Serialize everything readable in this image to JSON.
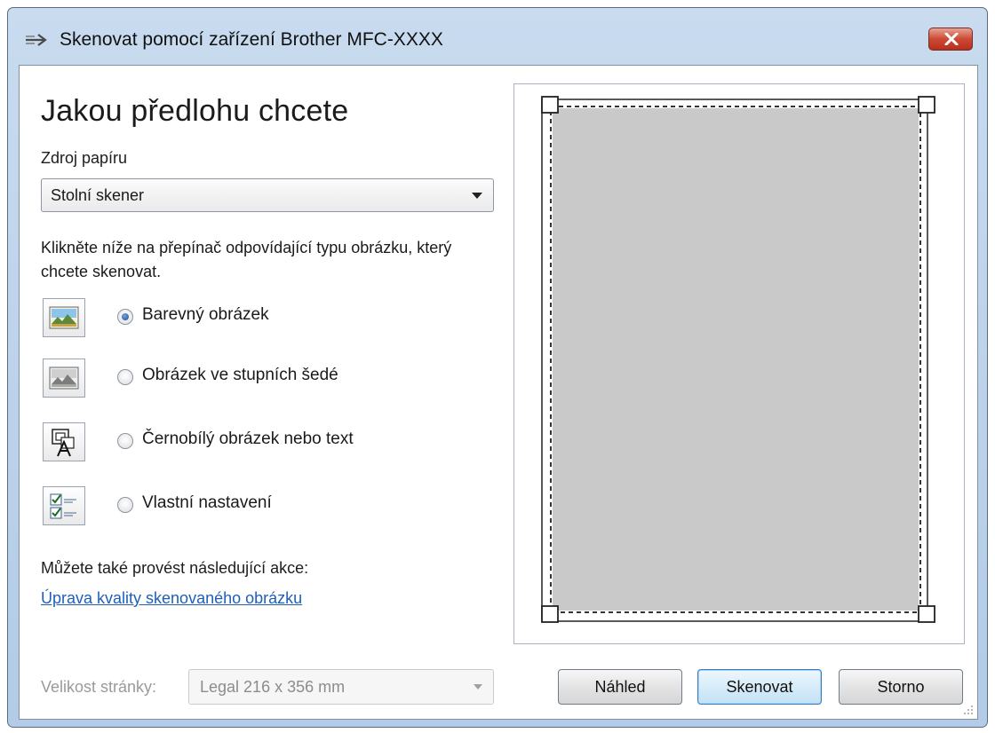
{
  "window": {
    "title": "Skenovat pomocí zařízení Brother MFC-XXXX"
  },
  "main": {
    "heading": "Jakou předlohu chcete",
    "paper_source_label": "Zdroj papíru",
    "paper_source_value": "Stolní skener",
    "instructions": "Klikněte níže na přepínač odpovídající typu obrázku, který chcete skenovat.",
    "options": [
      {
        "label": "Barevný obrázek",
        "icon": "color-photo-icon",
        "selected": true
      },
      {
        "label": "Obrázek ve stupních šedé",
        "icon": "grayscale-photo-icon",
        "selected": false
      },
      {
        "label": "Černobílý obrázek nebo text",
        "icon": "black-white-text-icon",
        "selected": false
      },
      {
        "label": "Vlastní nastavení",
        "icon": "custom-settings-icon",
        "selected": false
      }
    ],
    "more_actions_label": "Můžete také provést následující akce:",
    "adjust_quality_link": "Úprava kvality skenovaného obrázku",
    "page_size_label": "Velikost stránky:",
    "page_size_value": "Legal 216 x 356 mm"
  },
  "buttons": {
    "preview": "Náhled",
    "scan": "Skenovat",
    "cancel": "Storno"
  },
  "colors": {
    "title_bar": "#c8dbef",
    "close_button": "#cc4a33",
    "link": "#1f5fb8",
    "preview_page": "#c9c9c9"
  }
}
